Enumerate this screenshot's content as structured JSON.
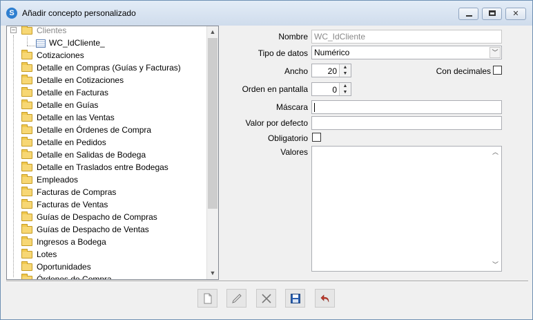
{
  "window": {
    "title": "Añadir concepto personalizado",
    "icon": "app-logo-icon"
  },
  "tree": {
    "root": {
      "label": "Clientes",
      "expanded": true,
      "icon": "folder-icon",
      "children": [
        {
          "label": "WC_IdCliente_",
          "icon": "table-field-icon"
        }
      ]
    },
    "items": [
      "Cotizaciones",
      "Detalle en Compras (Guías y Facturas)",
      "Detalle en Cotizaciones",
      "Detalle en Facturas",
      "Detalle en Guías",
      "Detalle en las Ventas",
      "Detalle en Órdenes de Compra",
      "Detalle en Pedidos",
      "Detalle en Salidas de Bodega",
      "Detalle en Traslados entre Bodegas",
      "Empleados",
      "Facturas de Compras",
      "Facturas de Ventas",
      "Guías de Despacho de Compras",
      "Guías de Despacho de Ventas",
      "Ingresos a Bodega",
      "Lotes",
      "Oportunidades",
      "Órdenes de Compra"
    ]
  },
  "form": {
    "nombre_label": "Nombre",
    "nombre_value": "WC_IdCliente",
    "tipo_label": "Tipo de datos",
    "tipo_value": "Numérico",
    "ancho_label": "Ancho",
    "ancho_value": "20",
    "decimales_label": "Con decimales",
    "orden_label": "Orden en pantalla",
    "orden_value": "0",
    "mascara_label": "Máscara",
    "mascara_value": "",
    "defecto_label": "Valor por defecto",
    "defecto_value": "",
    "obligatorio_label": "Obligatorio",
    "valores_label": "Valores"
  },
  "toolbar": {
    "buttons": [
      "new-icon",
      "edit-icon",
      "delete-icon",
      "save-icon",
      "undo-icon"
    ]
  },
  "colors": {
    "folder": "#f7d774",
    "accent": "#2f7fd0",
    "save": "#2a5fb0",
    "undo": "#c0392b"
  }
}
